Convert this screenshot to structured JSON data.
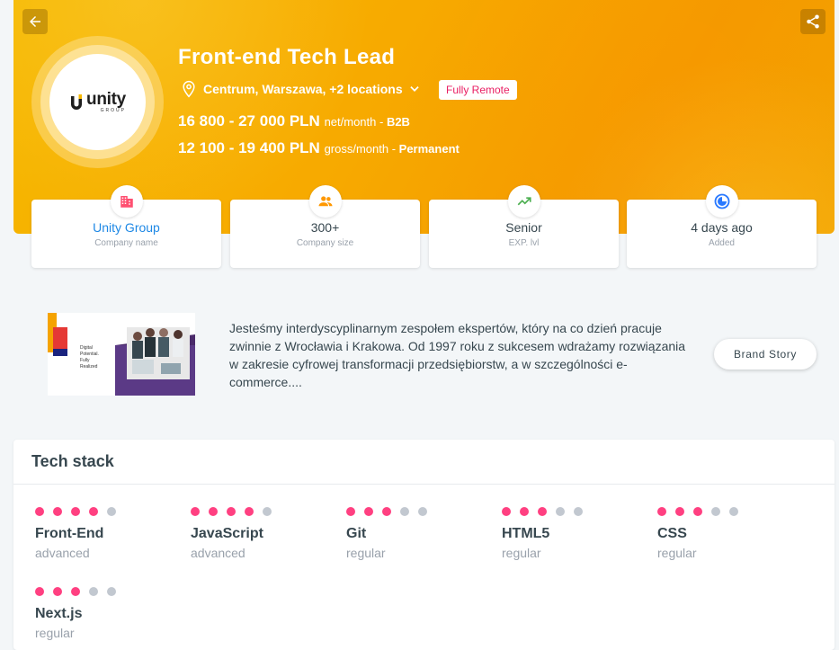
{
  "header": {
    "title": "Front-end Tech Lead",
    "location": "Centrum, Warszawa, +2 locations",
    "remote_badge": "Fully Remote",
    "salary_b2b": {
      "range": "16 800 - 27 000 PLN",
      "unit": "net/month - ",
      "type": "B2B"
    },
    "salary_perm": {
      "range": "12 100 - 19 400 PLN",
      "unit": "gross/month - ",
      "type": "Permanent"
    },
    "logo": {
      "word": "unity",
      "sub": "GROUP"
    },
    "colors": {
      "accent": "#f6b800",
      "badge": "#e91e63",
      "link": "#1e88e5",
      "dot_on": "#ff4081"
    }
  },
  "stats": [
    {
      "value": "Unity Group",
      "label": "Company name",
      "icon": "building-icon"
    },
    {
      "value": "300+",
      "label": "Company size",
      "icon": "people-icon"
    },
    {
      "value": "Senior",
      "label": "EXP. lvl",
      "icon": "trending-up-icon"
    },
    {
      "value": "4 days ago",
      "label": "Added",
      "icon": "clock-icon"
    }
  ],
  "company": {
    "description": "Jesteśmy interdyscyplinarnym zespołem ekspertów, który na co dzień pracuje zwinnie z Wrocławia i Krakowa. Od 1997 roku z sukcesem wdrażamy rozwiązania w zakresie cyfrowej transformacji przedsiębiorstw, a w szczególności e-commerce....",
    "brand_button": "Brand Story",
    "promo_lines": [
      "Digital",
      "Potential.",
      "Fully",
      "Realized"
    ]
  },
  "tech_stack": {
    "title": "Tech stack",
    "skills": [
      {
        "name": "Front-End",
        "level": "advanced",
        "dots": 4
      },
      {
        "name": "JavaScript",
        "level": "advanced",
        "dots": 4
      },
      {
        "name": "Git",
        "level": "regular",
        "dots": 3
      },
      {
        "name": "HTML5",
        "level": "regular",
        "dots": 3
      },
      {
        "name": "CSS",
        "level": "regular",
        "dots": 3
      },
      {
        "name": "Next.js",
        "level": "regular",
        "dots": 3
      }
    ]
  }
}
